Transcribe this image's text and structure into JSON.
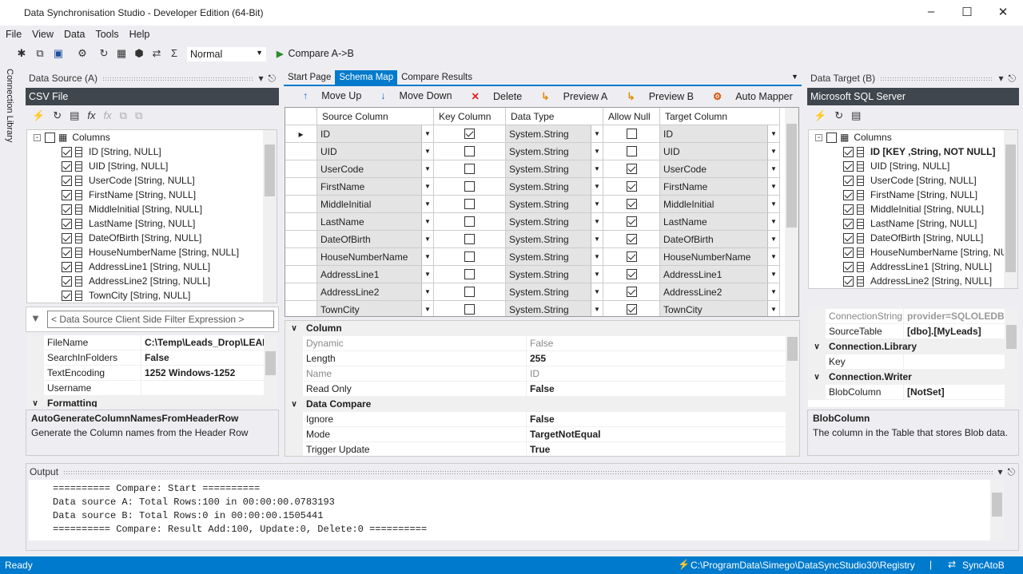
{
  "window": {
    "title": "Data Synchronisation Studio - Developer Edition (64-Bit)"
  },
  "menu": [
    "File",
    "View",
    "Data",
    "Tools",
    "Help"
  ],
  "toolbar": {
    "mode": "Normal",
    "compare": "Compare A->B"
  },
  "connection_library": "Connection Library",
  "source": {
    "header": "Data Source (A)",
    "type": "CSV File",
    "root": "Columns",
    "columns": [
      "ID [String, NULL]",
      "UID [String, NULL]",
      "UserCode [String, NULL]",
      "FirstName [String, NULL]",
      "MiddleInitial [String, NULL]",
      "LastName [String, NULL]",
      "DateOfBirth [String, NULL]",
      "HouseNumberName [String, NULL]",
      "AddressLine1 [String, NULL]",
      "AddressLine2 [String, NULL]",
      "TownCity [String, NULL]"
    ],
    "filter_placeholder": "< Data Source Client Side Filter Expression >",
    "properties": [
      {
        "name": "FileName",
        "value": "C:\\Temp\\Leads_Drop\\LEAD"
      },
      {
        "name": "SearchInFolders",
        "value": "False"
      },
      {
        "name": "TextEncoding",
        "value": "1252    Windows-1252"
      },
      {
        "name": "Username",
        "value": ""
      },
      {
        "name": "Formatting",
        "value": "",
        "category": true
      }
    ],
    "desc_title": "AutoGenerateColumnNamesFromHeaderRow",
    "desc_text": "Generate the Column names from the Header Row"
  },
  "tabs": [
    {
      "label": "Start Page"
    },
    {
      "label": "Schema Map",
      "active": true
    },
    {
      "label": "Compare Results"
    }
  ],
  "schema_toolbar": [
    {
      "icon": "arrow-up-icon",
      "label": "Move Up"
    },
    {
      "icon": "arrow-down-icon",
      "label": "Move Down"
    },
    {
      "icon": "delete-icon",
      "label": "Delete"
    },
    {
      "icon": "preview-icon",
      "label": "Preview A"
    },
    {
      "icon": "preview-icon",
      "label": "Preview B"
    },
    {
      "icon": "auto-mapper-icon",
      "label": "Auto Mapper"
    }
  ],
  "schema": {
    "headers": [
      "Source Column",
      "Key Column",
      "Data Type",
      "Allow Null",
      "Target Column"
    ],
    "rows": [
      {
        "source": "ID",
        "key": true,
        "type": "System.String",
        "null": false,
        "target": "ID"
      },
      {
        "source": "UID",
        "key": false,
        "type": "System.String",
        "null": false,
        "target": "UID"
      },
      {
        "source": "UserCode",
        "key": false,
        "type": "System.String",
        "null": true,
        "target": "UserCode"
      },
      {
        "source": "FirstName",
        "key": false,
        "type": "System.String",
        "null": true,
        "target": "FirstName"
      },
      {
        "source": "MiddleInitial",
        "key": false,
        "type": "System.String",
        "null": true,
        "target": "MiddleInitial"
      },
      {
        "source": "LastName",
        "key": false,
        "type": "System.String",
        "null": true,
        "target": "LastName"
      },
      {
        "source": "DateOfBirth",
        "key": false,
        "type": "System.String",
        "null": true,
        "target": "DateOfBirth"
      },
      {
        "source": "HouseNumberName",
        "key": false,
        "type": "System.String",
        "null": true,
        "target": "HouseNumberName"
      },
      {
        "source": "AddressLine1",
        "key": false,
        "type": "System.String",
        "null": true,
        "target": "AddressLine1"
      },
      {
        "source": "AddressLine2",
        "key": false,
        "type": "System.String",
        "null": true,
        "target": "AddressLine2"
      },
      {
        "source": "TownCity",
        "key": false,
        "type": "System.String",
        "null": true,
        "target": "TownCity"
      }
    ]
  },
  "column_properties": [
    {
      "name": "Column",
      "category": true
    },
    {
      "name": "Dynamic",
      "value": "False",
      "grey": true
    },
    {
      "name": "Length",
      "value": "255"
    },
    {
      "name": "Name",
      "value": "ID",
      "grey": true
    },
    {
      "name": "Read Only",
      "value": "False"
    },
    {
      "name": "Data Compare",
      "category": true
    },
    {
      "name": "Ignore",
      "value": "False"
    },
    {
      "name": "Mode",
      "value": "TargetNotEqual"
    },
    {
      "name": "Trigger Update",
      "value": "True"
    }
  ],
  "target": {
    "header": "Data Target (B)",
    "type": "Microsoft SQL Server",
    "root": "Columns",
    "columns": [
      "ID [KEY ,String, NOT NULL]",
      "UID [String, NULL]",
      "UserCode [String, NULL]",
      "FirstName [String, NULL]",
      "MiddleInitial [String, NULL]",
      "LastName [String, NULL]",
      "DateOfBirth [String, NULL]",
      "HouseNumberName [String, NULL]",
      "AddressLine1 [String, NULL]",
      "AddressLine2 [String, NULL]"
    ],
    "properties": [
      {
        "name": "ConnectionString",
        "value": "provider=SQLOLEDB;",
        "grey": true
      },
      {
        "name": "SourceTable",
        "value": "[dbo].[MyLeads]"
      },
      {
        "name": "Connection.Library",
        "category": true
      },
      {
        "name": "Key",
        "value": ""
      },
      {
        "name": "Connection.Writer",
        "category": true
      },
      {
        "name": "BlobColumn",
        "value": "[NotSet]"
      }
    ],
    "desc_title": "BlobColumn",
    "desc_text": "The column in the Table that stores Blob data."
  },
  "output": {
    "header": "Output",
    "lines": [
      "========== Compare: Start ==========",
      "Data source A: Total Rows:100 in 00:00:00.0783193",
      "Data source B: Total Rows:0 in 00:00:00.1505441",
      "========== Compare: Result Add:100, Update:0, Delete:0 =========="
    ]
  },
  "status": {
    "left": "Ready",
    "path": "C:\\ProgramData\\Simego\\DataSyncStudio30\\Registry",
    "sync": "SyncAtoB"
  },
  "colors": {
    "accent": "#007acc",
    "dark_header": "#3f464d"
  }
}
